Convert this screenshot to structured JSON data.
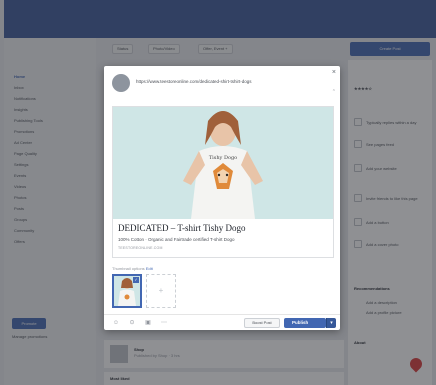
{
  "page": {
    "sidebar": {
      "items": [
        "Home",
        "Inbox",
        "Notifications",
        "Insights",
        "Publishing Tools",
        "Promotions",
        "Ad Center",
        "Page Quality",
        "Settings",
        "Events",
        "Videos",
        "Photos",
        "Posts",
        "Groups",
        "Community",
        "Offers"
      ],
      "active_index": 0,
      "button_label": "Promote",
      "footer_link": "Manage promotions"
    },
    "toolbar": {
      "items": [
        "Status",
        "Photo/Video",
        "Offer, Event +"
      ],
      "action_label": "Create Post"
    },
    "right_panel": {
      "rating": "★★★★☆",
      "items": [
        "Typically replies within a day",
        "See pages feed",
        "Add your website",
        "Invite friends to like this page",
        "Add a button",
        "Add a cover photo"
      ],
      "section_heading": "Recommendations",
      "section_items": [
        "Add a description",
        "Add a profile picture"
      ],
      "about_heading": "About"
    },
    "below_post": {
      "name": "Shop",
      "meta": "Published by Shop · 3 hrs",
      "next_heading": "Most liked"
    }
  },
  "modal": {
    "composer_text": "https://www.teestoreonline.com/dedicated-shirt-tshirt-dogs",
    "preview": {
      "title": "DEDICATED – T-shirt Tishy Dogo",
      "description": "100% Cotton · Organic and Fairtrade certified T-shirt Dogo",
      "domain": "TEESTOREONLINE.COM"
    },
    "thumbnail_label": "Thumbnail options",
    "thumbnail_link": "Edit",
    "thumbnail_check": "✓",
    "footer": {
      "schedule_label": "Boost Post",
      "publish_label": "Publish",
      "caret": "▾"
    }
  },
  "colors": {
    "brand_blue": "#4267b2",
    "topbar_blue": "#3b5998",
    "pin_red": "#d93a3a"
  },
  "icons": {
    "close": "close-icon",
    "footer": [
      "emoji-icon",
      "location-icon",
      "camera-icon",
      "more-icon"
    ]
  }
}
